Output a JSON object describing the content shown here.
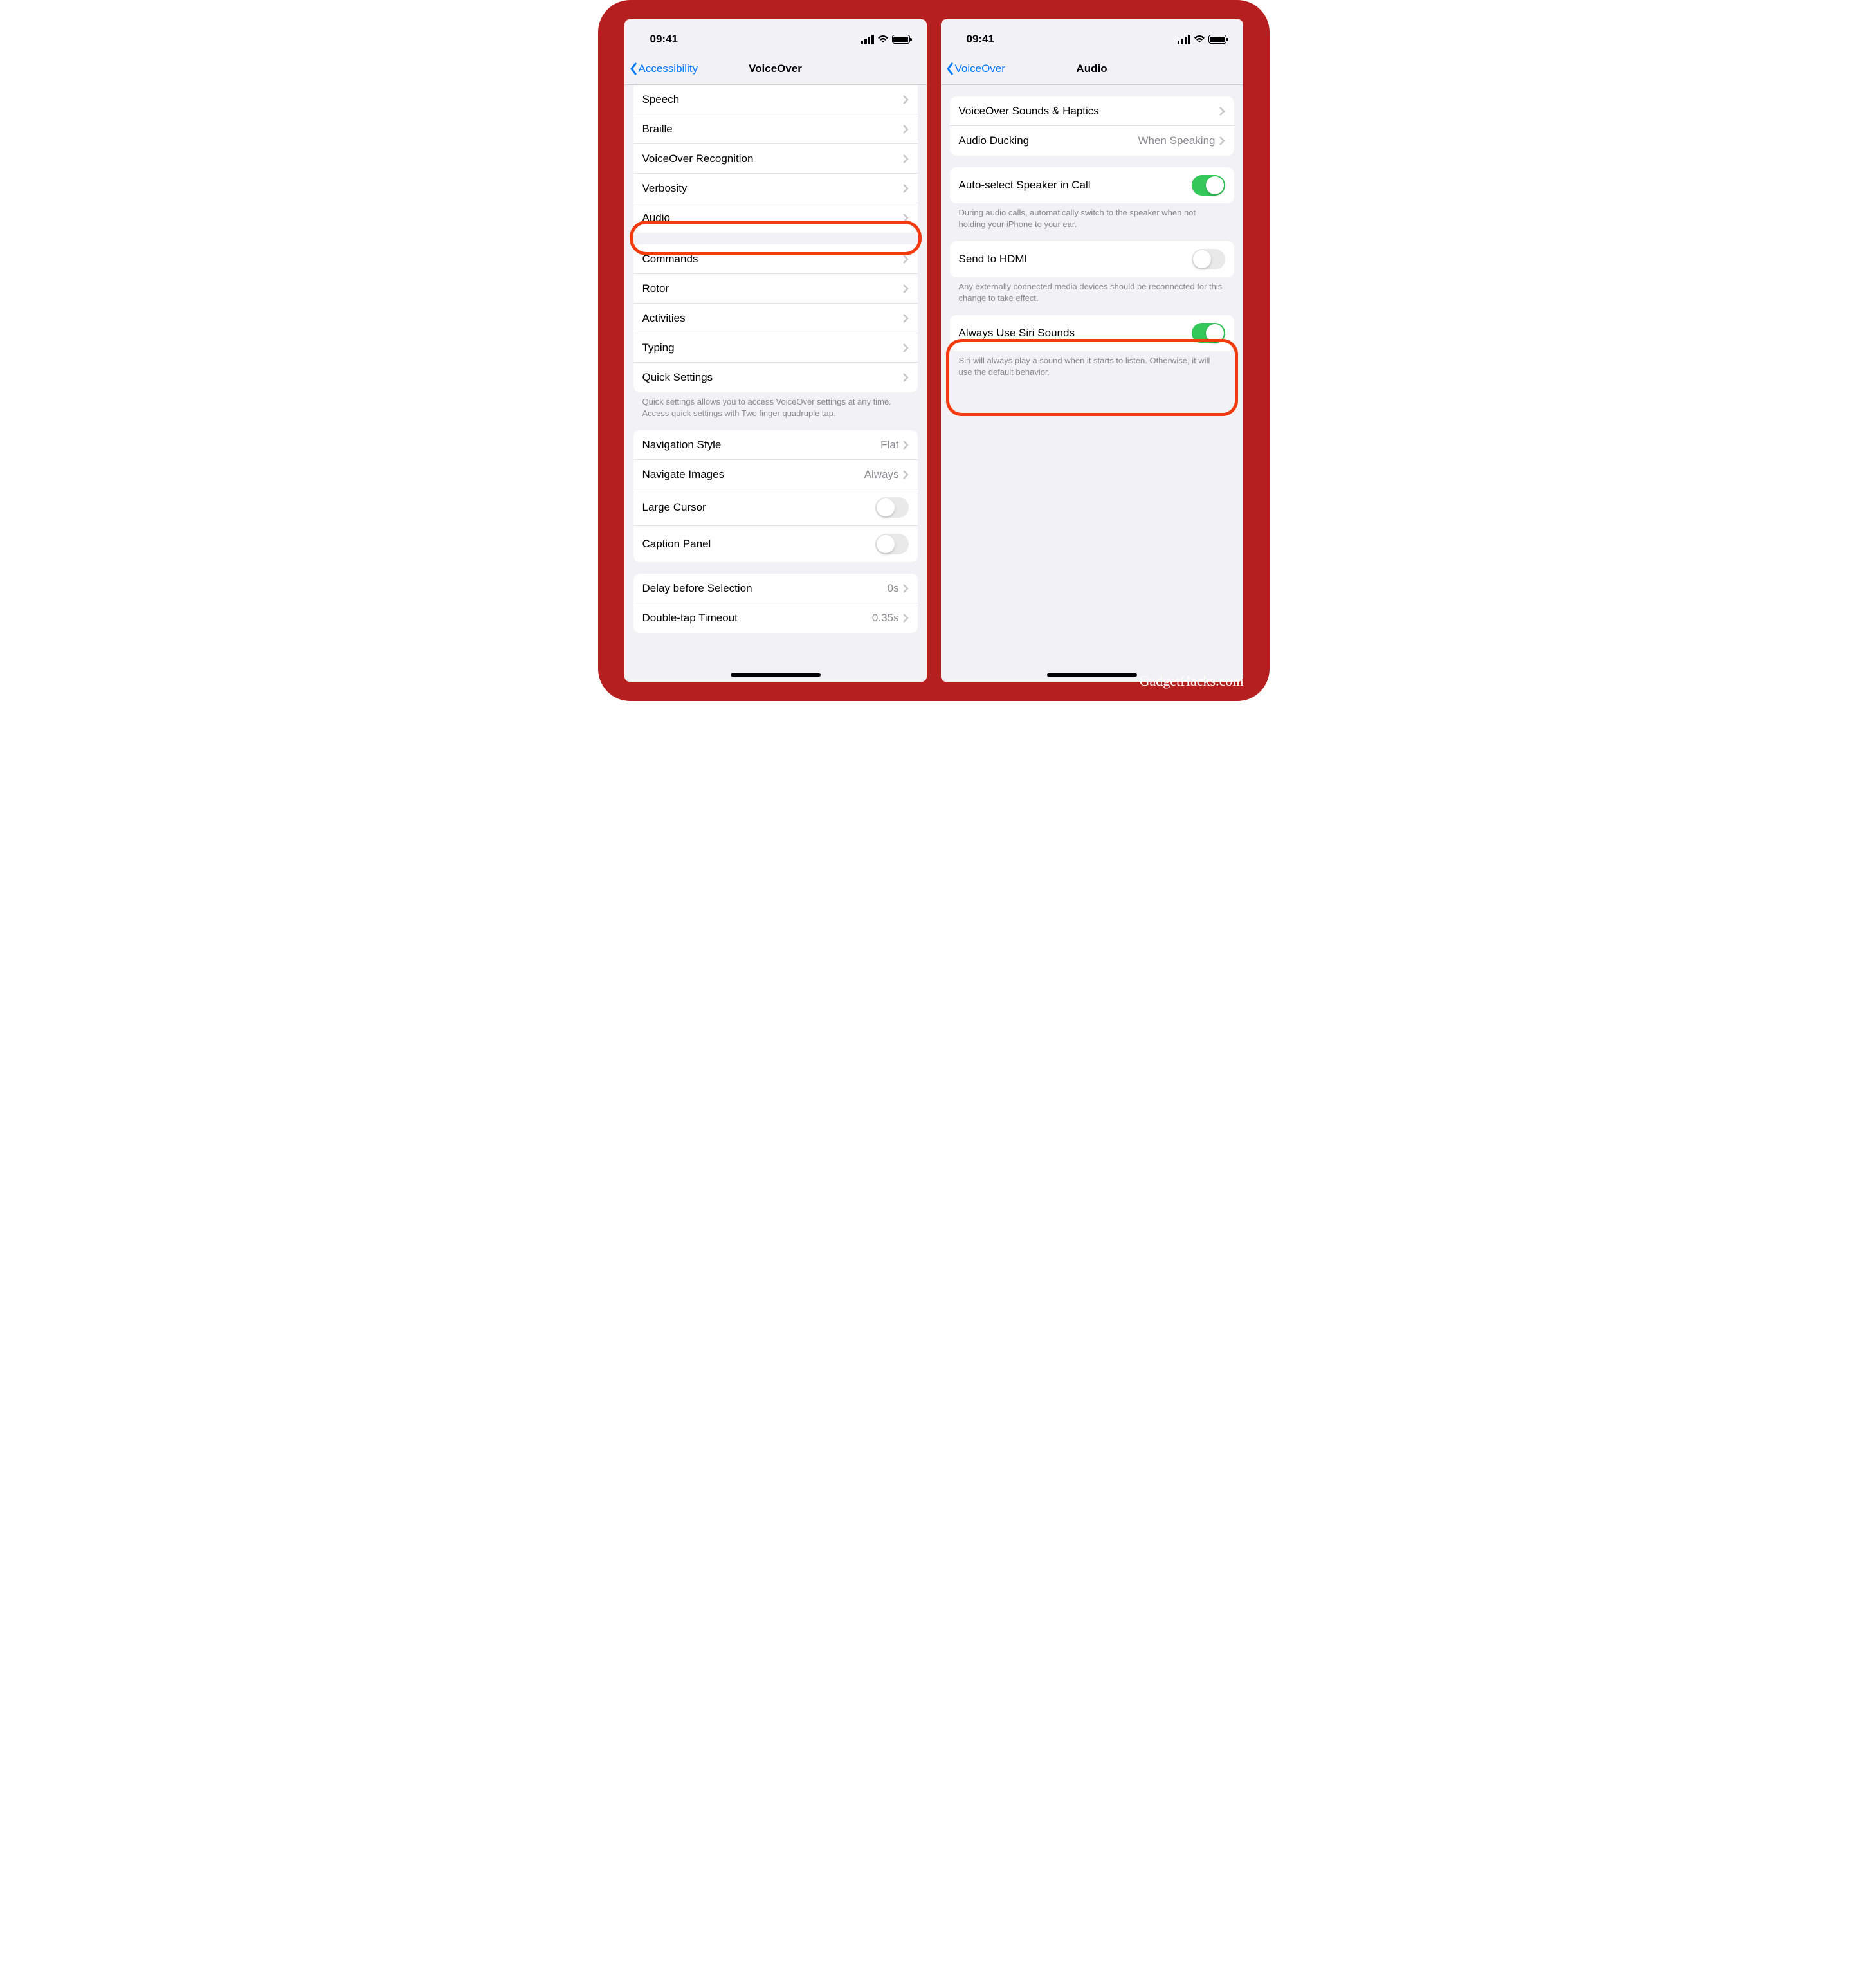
{
  "watermark": "GadgetHacks.com",
  "statusbar": {
    "time": "09:41"
  },
  "left": {
    "back_label": "Accessibility",
    "title": "VoiceOver",
    "group1": [
      {
        "label": "Speech"
      },
      {
        "label": "Braille"
      },
      {
        "label": "VoiceOver Recognition"
      },
      {
        "label": "Verbosity"
      },
      {
        "label": "Audio"
      }
    ],
    "group2": [
      {
        "label": "Commands"
      },
      {
        "label": "Rotor"
      },
      {
        "label": "Activities"
      },
      {
        "label": "Typing"
      },
      {
        "label": "Quick Settings"
      }
    ],
    "group2_footer": "Quick settings allows you to access VoiceOver settings at any time. Access quick settings with Two finger quadruple tap.",
    "group3": [
      {
        "label": "Navigation Style",
        "value": "Flat",
        "type": "link"
      },
      {
        "label": "Navigate Images",
        "value": "Always",
        "type": "link"
      },
      {
        "label": "Large Cursor",
        "type": "toggle",
        "on": false
      },
      {
        "label": "Caption Panel",
        "type": "toggle",
        "on": false
      }
    ],
    "group4": [
      {
        "label": "Delay before Selection",
        "value": "0s"
      },
      {
        "label": "Double-tap Timeout",
        "value": "0.35s"
      }
    ]
  },
  "right": {
    "back_label": "VoiceOver",
    "title": "Audio",
    "group1": [
      {
        "label": "VoiceOver Sounds & Haptics",
        "type": "link"
      },
      {
        "label": "Audio Ducking",
        "value": "When Speaking",
        "type": "link"
      }
    ],
    "group2": [
      {
        "label": "Auto-select Speaker in Call",
        "type": "toggle",
        "on": true
      }
    ],
    "group2_footer": "During audio calls, automatically switch to the speaker when not holding your iPhone to your ear.",
    "group3": [
      {
        "label": "Send to HDMI",
        "type": "toggle",
        "on": false
      }
    ],
    "group3_footer": "Any externally connected media devices should be reconnected for this change to take effect.",
    "group4": [
      {
        "label": "Always Use Siri Sounds",
        "type": "toggle",
        "on": true
      }
    ],
    "group4_footer": "Siri will always play a sound when it starts to listen. Otherwise, it will use the default behavior."
  }
}
